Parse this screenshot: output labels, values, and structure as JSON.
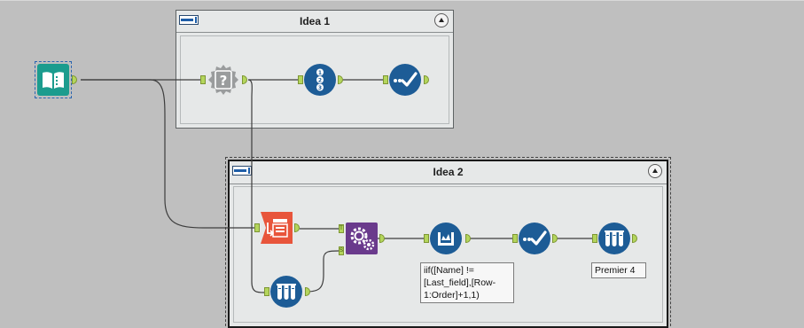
{
  "containers": [
    {
      "title": "Idea 1"
    },
    {
      "title": "Idea 2"
    }
  ],
  "anchors": {
    "input_t": "T",
    "input_s": "S"
  },
  "annotations": {
    "formula": "iif([Name] != [Last_field],[Row-1:Order]+1,1)",
    "sample": "Premier 4"
  },
  "colors": {
    "canvas": "#bfbfbf",
    "container_bg": "#e6e8e8",
    "tool_blue": "#1d5c96",
    "tool_teal": "#1b9c8e",
    "tool_orange": "#e8553b",
    "tool_purple": "#6a3a8c",
    "anchor_green": "#b4d55c"
  },
  "icons": {
    "input": "book-input-icon",
    "test": "question-gear-icon",
    "record_id": "numbered-list-icon",
    "browse": "checkmark-browse-icon",
    "join": "join-table-icon",
    "multirow": "gears-icon",
    "formula": "flask-formula-icon",
    "sample": "test-tubes-icon"
  }
}
